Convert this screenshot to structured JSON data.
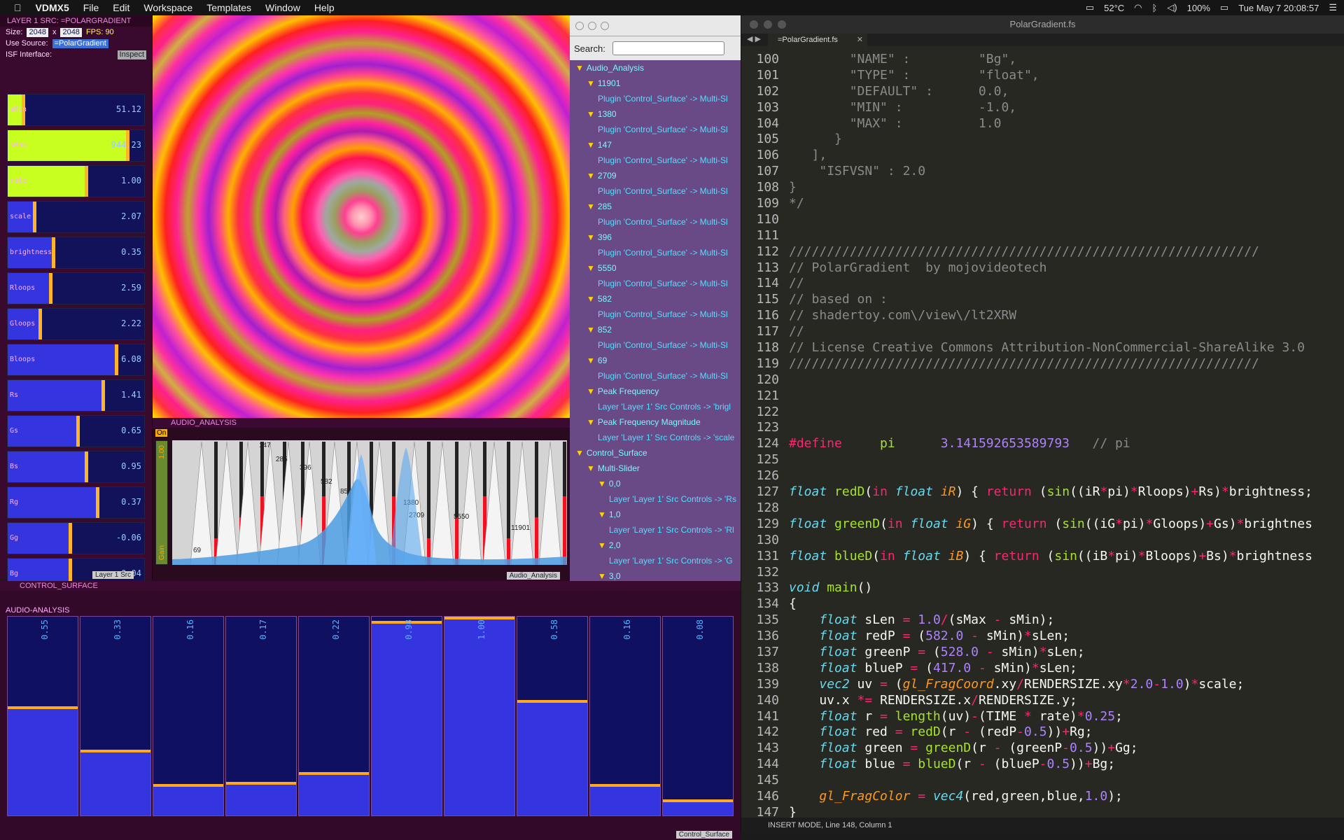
{
  "menubar": {
    "apple": "",
    "app": "VDMX5",
    "items": [
      "File",
      "Edit",
      "Workspace",
      "Templates",
      "Window",
      "Help"
    ],
    "status": {
      "temp": "52°C",
      "battery": "100%",
      "datetime": "Tue May 7  20:08:57"
    }
  },
  "layer": {
    "title": "LAYER 1 SRC: =POLARGRADIENT",
    "size_label": "Size:",
    "size_w": "2048",
    "size_x": "x",
    "size_h": "2048",
    "fps": "FPS: 90",
    "use_source_label": "Use Source:",
    "use_source_value": "=PolarGradient",
    "isf_label": "ISF Interface:",
    "inspect": "Inspect",
    "tab": "Layer 1 Src",
    "sliders": [
      {
        "name": "sMin",
        "value": "51.12",
        "level": 0.12,
        "color": "#c8ff20"
      },
      {
        "name": "sMax",
        "value": "944.23",
        "level": 0.88,
        "color": "#c8ff20"
      },
      {
        "name": "rate",
        "value": "1.00",
        "level": 0.58,
        "color": "#c8ff20"
      },
      {
        "name": "scale",
        "value": "2.07",
        "level": 0.2,
        "color": "#3535e0"
      },
      {
        "name": "brightness",
        "value": "0.35",
        "level": 0.34,
        "color": "#3535e0"
      },
      {
        "name": "Rloops",
        "value": "2.59",
        "level": 0.32,
        "color": "#3535e0"
      },
      {
        "name": "Gloops",
        "value": "2.22",
        "level": 0.24,
        "color": "#3535e0"
      },
      {
        "name": "Bloops",
        "value": "6.08",
        "level": 0.8,
        "color": "#3535e0"
      },
      {
        "name": "Rs",
        "value": "1.41",
        "level": 0.7,
        "color": "#3535e0"
      },
      {
        "name": "Gs",
        "value": "0.65",
        "level": 0.52,
        "color": "#3535e0"
      },
      {
        "name": "Bs",
        "value": "0.95",
        "level": 0.58,
        "color": "#3535e0"
      },
      {
        "name": "Rg",
        "value": "0.37",
        "level": 0.66,
        "color": "#3535e0"
      },
      {
        "name": "Gg",
        "value": "-0.06",
        "level": 0.46,
        "color": "#3535e0"
      },
      {
        "name": "Bg",
        "value": "-0.04",
        "level": 0.46,
        "color": "#3535e0"
      }
    ]
  },
  "audio": {
    "title": "AUDIO_ANALYSIS",
    "on": "On",
    "gain": "Gain",
    "gain_value": "1.00",
    "tab": "Audio_Analysis",
    "peak_labels": [
      "147",
      "285",
      "396",
      "582",
      "852",
      "1380",
      "2709",
      "5550",
      "11901",
      "69"
    ]
  },
  "search": {
    "label": "Search:",
    "tree": [
      {
        "indent": 0,
        "arrow": true,
        "text": "Audio_Analysis",
        "plug": false
      },
      {
        "indent": 1,
        "arrow": true,
        "text": "11901",
        "plug": false
      },
      {
        "indent": 2,
        "arrow": false,
        "text": "Plugin 'Control_Surface' -> Multi-Sl",
        "plug": true
      },
      {
        "indent": 1,
        "arrow": true,
        "text": "1380",
        "plug": false
      },
      {
        "indent": 2,
        "arrow": false,
        "text": "Plugin 'Control_Surface' -> Multi-Sl",
        "plug": true
      },
      {
        "indent": 1,
        "arrow": true,
        "text": "147",
        "plug": false
      },
      {
        "indent": 2,
        "arrow": false,
        "text": "Plugin 'Control_Surface' -> Multi-Sl",
        "plug": true
      },
      {
        "indent": 1,
        "arrow": true,
        "text": "2709",
        "plug": false
      },
      {
        "indent": 2,
        "arrow": false,
        "text": "Plugin 'Control_Surface' -> Multi-Sl",
        "plug": true
      },
      {
        "indent": 1,
        "arrow": true,
        "text": "285",
        "plug": false
      },
      {
        "indent": 2,
        "arrow": false,
        "text": "Plugin 'Control_Surface' -> Multi-Sl",
        "plug": true
      },
      {
        "indent": 1,
        "arrow": true,
        "text": "396",
        "plug": false
      },
      {
        "indent": 2,
        "arrow": false,
        "text": "Plugin 'Control_Surface' -> Multi-Sl",
        "plug": true
      },
      {
        "indent": 1,
        "arrow": true,
        "text": "5550",
        "plug": false
      },
      {
        "indent": 2,
        "arrow": false,
        "text": "Plugin 'Control_Surface' -> Multi-Sl",
        "plug": true
      },
      {
        "indent": 1,
        "arrow": true,
        "text": "582",
        "plug": false
      },
      {
        "indent": 2,
        "arrow": false,
        "text": "Plugin 'Control_Surface' -> Multi-Sl",
        "plug": true
      },
      {
        "indent": 1,
        "arrow": true,
        "text": "852",
        "plug": false
      },
      {
        "indent": 2,
        "arrow": false,
        "text": "Plugin 'Control_Surface' -> Multi-Sl",
        "plug": true
      },
      {
        "indent": 1,
        "arrow": true,
        "text": "69",
        "plug": false
      },
      {
        "indent": 2,
        "arrow": false,
        "text": "Plugin 'Control_Surface' -> Multi-Sl",
        "plug": true
      },
      {
        "indent": 1,
        "arrow": true,
        "text": "Peak Frequency",
        "plug": false
      },
      {
        "indent": 2,
        "arrow": false,
        "text": "Layer 'Layer 1' Src Controls -> 'brigl",
        "plug": true
      },
      {
        "indent": 1,
        "arrow": true,
        "text": "Peak Frequency Magnitude",
        "plug": false
      },
      {
        "indent": 2,
        "arrow": false,
        "text": "Layer 'Layer 1' Src Controls -> 'scale",
        "plug": true
      },
      {
        "indent": 0,
        "arrow": true,
        "text": "Control_Surface",
        "plug": false
      },
      {
        "indent": 1,
        "arrow": true,
        "text": "Multi-Slider",
        "plug": false
      },
      {
        "indent": 2,
        "arrow": true,
        "text": "0,0",
        "plug": false
      },
      {
        "indent": 3,
        "arrow": false,
        "text": "Layer 'Layer 1' Src Controls -> 'Rs",
        "plug": true
      },
      {
        "indent": 2,
        "arrow": true,
        "text": "1,0",
        "plug": false
      },
      {
        "indent": 3,
        "arrow": false,
        "text": "Layer 'Layer 1' Src Controls -> 'Rl",
        "plug": true
      },
      {
        "indent": 2,
        "arrow": true,
        "text": "2,0",
        "plug": false
      },
      {
        "indent": 3,
        "arrow": false,
        "text": "Layer 'Layer 1' Src Controls -> 'G",
        "plug": true
      },
      {
        "indent": 2,
        "arrow": true,
        "text": "3,0",
        "plug": false
      }
    ]
  },
  "editor": {
    "title": "PolarGradient.fs",
    "tab": "=PolarGradient.fs",
    "status": "INSERT MODE, Line 148, Column 1",
    "lines": [
      {
        "n": "100",
        "h": "        <span class=\"cm\">\"NAME\" :         \"Bg\",</span>"
      },
      {
        "n": "101",
        "h": "        <span class=\"cm\">\"TYPE\" :         \"float\",</span>"
      },
      {
        "n": "102",
        "h": "        <span class=\"cm\">\"DEFAULT\" :      0.0,</span>"
      },
      {
        "n": "103",
        "h": "        <span class=\"cm\">\"MIN\" :          -1.0,</span>"
      },
      {
        "n": "104",
        "h": "        <span class=\"cm\">\"MAX\" :          1.0</span>"
      },
      {
        "n": "105",
        "h": "      <span class=\"cm\">}</span>"
      },
      {
        "n": "106",
        "h": "   <span class=\"cm\">],</span>"
      },
      {
        "n": "107",
        "h": "    <span class=\"cm\">\"ISFVSN\" : 2.0</span>"
      },
      {
        "n": "108",
        "h": "<span class=\"cm\">}</span>"
      },
      {
        "n": "109",
        "h": "<span class=\"cm\">*/</span>"
      },
      {
        "n": "110",
        "h": ""
      },
      {
        "n": "111",
        "h": ""
      },
      {
        "n": "112",
        "h": "<span class=\"cm\">//////////////////////////////////////////////////////////////</span>"
      },
      {
        "n": "113",
        "h": "<span class=\"cm\">// PolarGradient  by mojovideotech</span>"
      },
      {
        "n": "114",
        "h": "<span class=\"cm\">//</span>"
      },
      {
        "n": "115",
        "h": "<span class=\"cm\">// based on :</span>"
      },
      {
        "n": "116",
        "h": "<span class=\"cm\">// shadertoy.com\\/view\\/lt2XRW</span>"
      },
      {
        "n": "117",
        "h": "<span class=\"cm\">//</span>"
      },
      {
        "n": "118",
        "h": "<span class=\"cm\">// License Creative Commons Attribution-NonCommercial-ShareAlike 3.0</span>"
      },
      {
        "n": "119",
        "h": "<span class=\"cm\">//////////////////////////////////////////////////////////////</span>"
      },
      {
        "n": "120",
        "h": ""
      },
      {
        "n": "121",
        "h": ""
      },
      {
        "n": "122",
        "h": ""
      },
      {
        "n": "123",
        "h": ""
      },
      {
        "n": "124",
        "h": "<span class=\"kw\">#define</span>     <span class=\"fn\">pi</span>      <span class=\"nm\">3.141592653589793</span>   <span class=\"cm\">// pi</span>"
      },
      {
        "n": "125",
        "h": ""
      },
      {
        "n": "126",
        "h": ""
      },
      {
        "n": "127",
        "h": "<span class=\"ty\">float</span> <span class=\"fn\">redD</span>(<span class=\"kw\">in</span> <span class=\"ty\">float</span> <span class=\"ar\">iR</span>) { <span class=\"kw\">return</span> (<span class=\"fn\">sin</span>((iR<span class=\"op\">*</span>pi)<span class=\"op\">*</span>Rloops)<span class=\"op\">+</span>Rs)<span class=\"op\">*</span>brightness;"
      },
      {
        "n": "128",
        "h": ""
      },
      {
        "n": "129",
        "h": "<span class=\"ty\">float</span> <span class=\"fn\">greenD</span>(<span class=\"kw\">in</span> <span class=\"ty\">float</span> <span class=\"ar\">iG</span>) { <span class=\"kw\">return</span> (<span class=\"fn\">sin</span>((iG<span class=\"op\">*</span>pi)<span class=\"op\">*</span>Gloops)<span class=\"op\">+</span>Gs)<span class=\"op\">*</span>brightnes"
      },
      {
        "n": "130",
        "h": ""
      },
      {
        "n": "131",
        "h": "<span class=\"ty\">float</span> <span class=\"fn\">blueD</span>(<span class=\"kw\">in</span> <span class=\"ty\">float</span> <span class=\"ar\">iB</span>) { <span class=\"kw\">return</span> (<span class=\"fn\">sin</span>((iB<span class=\"op\">*</span>pi)<span class=\"op\">*</span>Bloops)<span class=\"op\">+</span>Bs)<span class=\"op\">*</span>brightness"
      },
      {
        "n": "132",
        "h": ""
      },
      {
        "n": "133",
        "h": "<span class=\"ty\">void</span> <span class=\"fn\">main</span>()"
      },
      {
        "n": "134",
        "h": "{"
      },
      {
        "n": "135",
        "h": "    <span class=\"ty\">float</span> sLen <span class=\"op\">=</span> <span class=\"nm\">1.0</span><span class=\"op\">/</span>(sMax <span class=\"op\">-</span> sMin);"
      },
      {
        "n": "136",
        "h": "    <span class=\"ty\">float</span> redP <span class=\"op\">=</span> (<span class=\"nm\">582.0</span> <span class=\"op\">-</span> sMin)<span class=\"op\">*</span>sLen;"
      },
      {
        "n": "137",
        "h": "    <span class=\"ty\">float</span> greenP <span class=\"op\">=</span> (<span class=\"nm\">528.0</span> <span class=\"op\">-</span> sMin)<span class=\"op\">*</span>sLen;"
      },
      {
        "n": "138",
        "h": "    <span class=\"ty\">float</span> blueP <span class=\"op\">=</span> (<span class=\"nm\">417.0</span> <span class=\"op\">-</span> sMin)<span class=\"op\">*</span>sLen;"
      },
      {
        "n": "139",
        "h": "    <span class=\"ty\">vec2</span> uv <span class=\"op\">=</span> (<span class=\"ar\">gl_FragCoord</span>.xy<span class=\"op\">/</span>RENDERSIZE.xy<span class=\"op\">*</span><span class=\"nm\">2.0</span><span class=\"op\">-</span><span class=\"nm\">1.0</span>)<span class=\"op\">*</span>scale;"
      },
      {
        "n": "140",
        "h": "    uv.x <span class=\"op\">*=</span> RENDERSIZE.x<span class=\"op\">/</span>RENDERSIZE.y;"
      },
      {
        "n": "141",
        "h": "    <span class=\"ty\">float</span> r <span class=\"op\">=</span> <span class=\"fn\">length</span>(uv)<span class=\"op\">-</span>(TIME <span class=\"op\">*</span> rate)<span class=\"op\">*</span><span class=\"nm\">0.25</span>;"
      },
      {
        "n": "142",
        "h": "    <span class=\"ty\">float</span> red <span class=\"op\">=</span> <span class=\"fn\">redD</span>(r <span class=\"op\">-</span> (redP<span class=\"op\">-</span><span class=\"nm\">0.5</span>))<span class=\"op\">+</span>Rg;"
      },
      {
        "n": "143",
        "h": "    <span class=\"ty\">float</span> green <span class=\"op\">=</span> <span class=\"fn\">greenD</span>(r <span class=\"op\">-</span> (greenP<span class=\"op\">-</span><span class=\"nm\">0.5</span>))<span class=\"op\">+</span>Gg;"
      },
      {
        "n": "144",
        "h": "    <span class=\"ty\">float</span> blue <span class=\"op\">=</span> <span class=\"fn\">blueD</span>(r <span class=\"op\">-</span> (blueP<span class=\"op\">-</span><span class=\"nm\">0.5</span>))<span class=\"op\">+</span>Bg;"
      },
      {
        "n": "145",
        "h": ""
      },
      {
        "n": "146",
        "h": "    <span class=\"ar\">gl_FragColor</span> <span class=\"op\">=</span> <span class=\"ty\">vec4</span>(red,green,blue,<span class=\"nm\">1.0</span>);"
      },
      {
        "n": "147",
        "h": "}"
      }
    ]
  },
  "control": {
    "title": "CONTROL_SURFACE",
    "subtitle": "AUDIO-ANALYSIS",
    "tab": "Control_Surface",
    "bars": [
      {
        "value": "0.55",
        "level": 0.55
      },
      {
        "value": "0.33",
        "level": 0.33
      },
      {
        "value": "0.16",
        "level": 0.16
      },
      {
        "value": "0.17",
        "level": 0.17
      },
      {
        "value": "0.22",
        "level": 0.22
      },
      {
        "value": "0.98",
        "level": 0.98
      },
      {
        "value": "1.00",
        "level": 1.0
      },
      {
        "value": "0.58",
        "level": 0.58
      },
      {
        "value": "0.16",
        "level": 0.16
      },
      {
        "value": "0.08",
        "level": 0.08
      }
    ]
  }
}
